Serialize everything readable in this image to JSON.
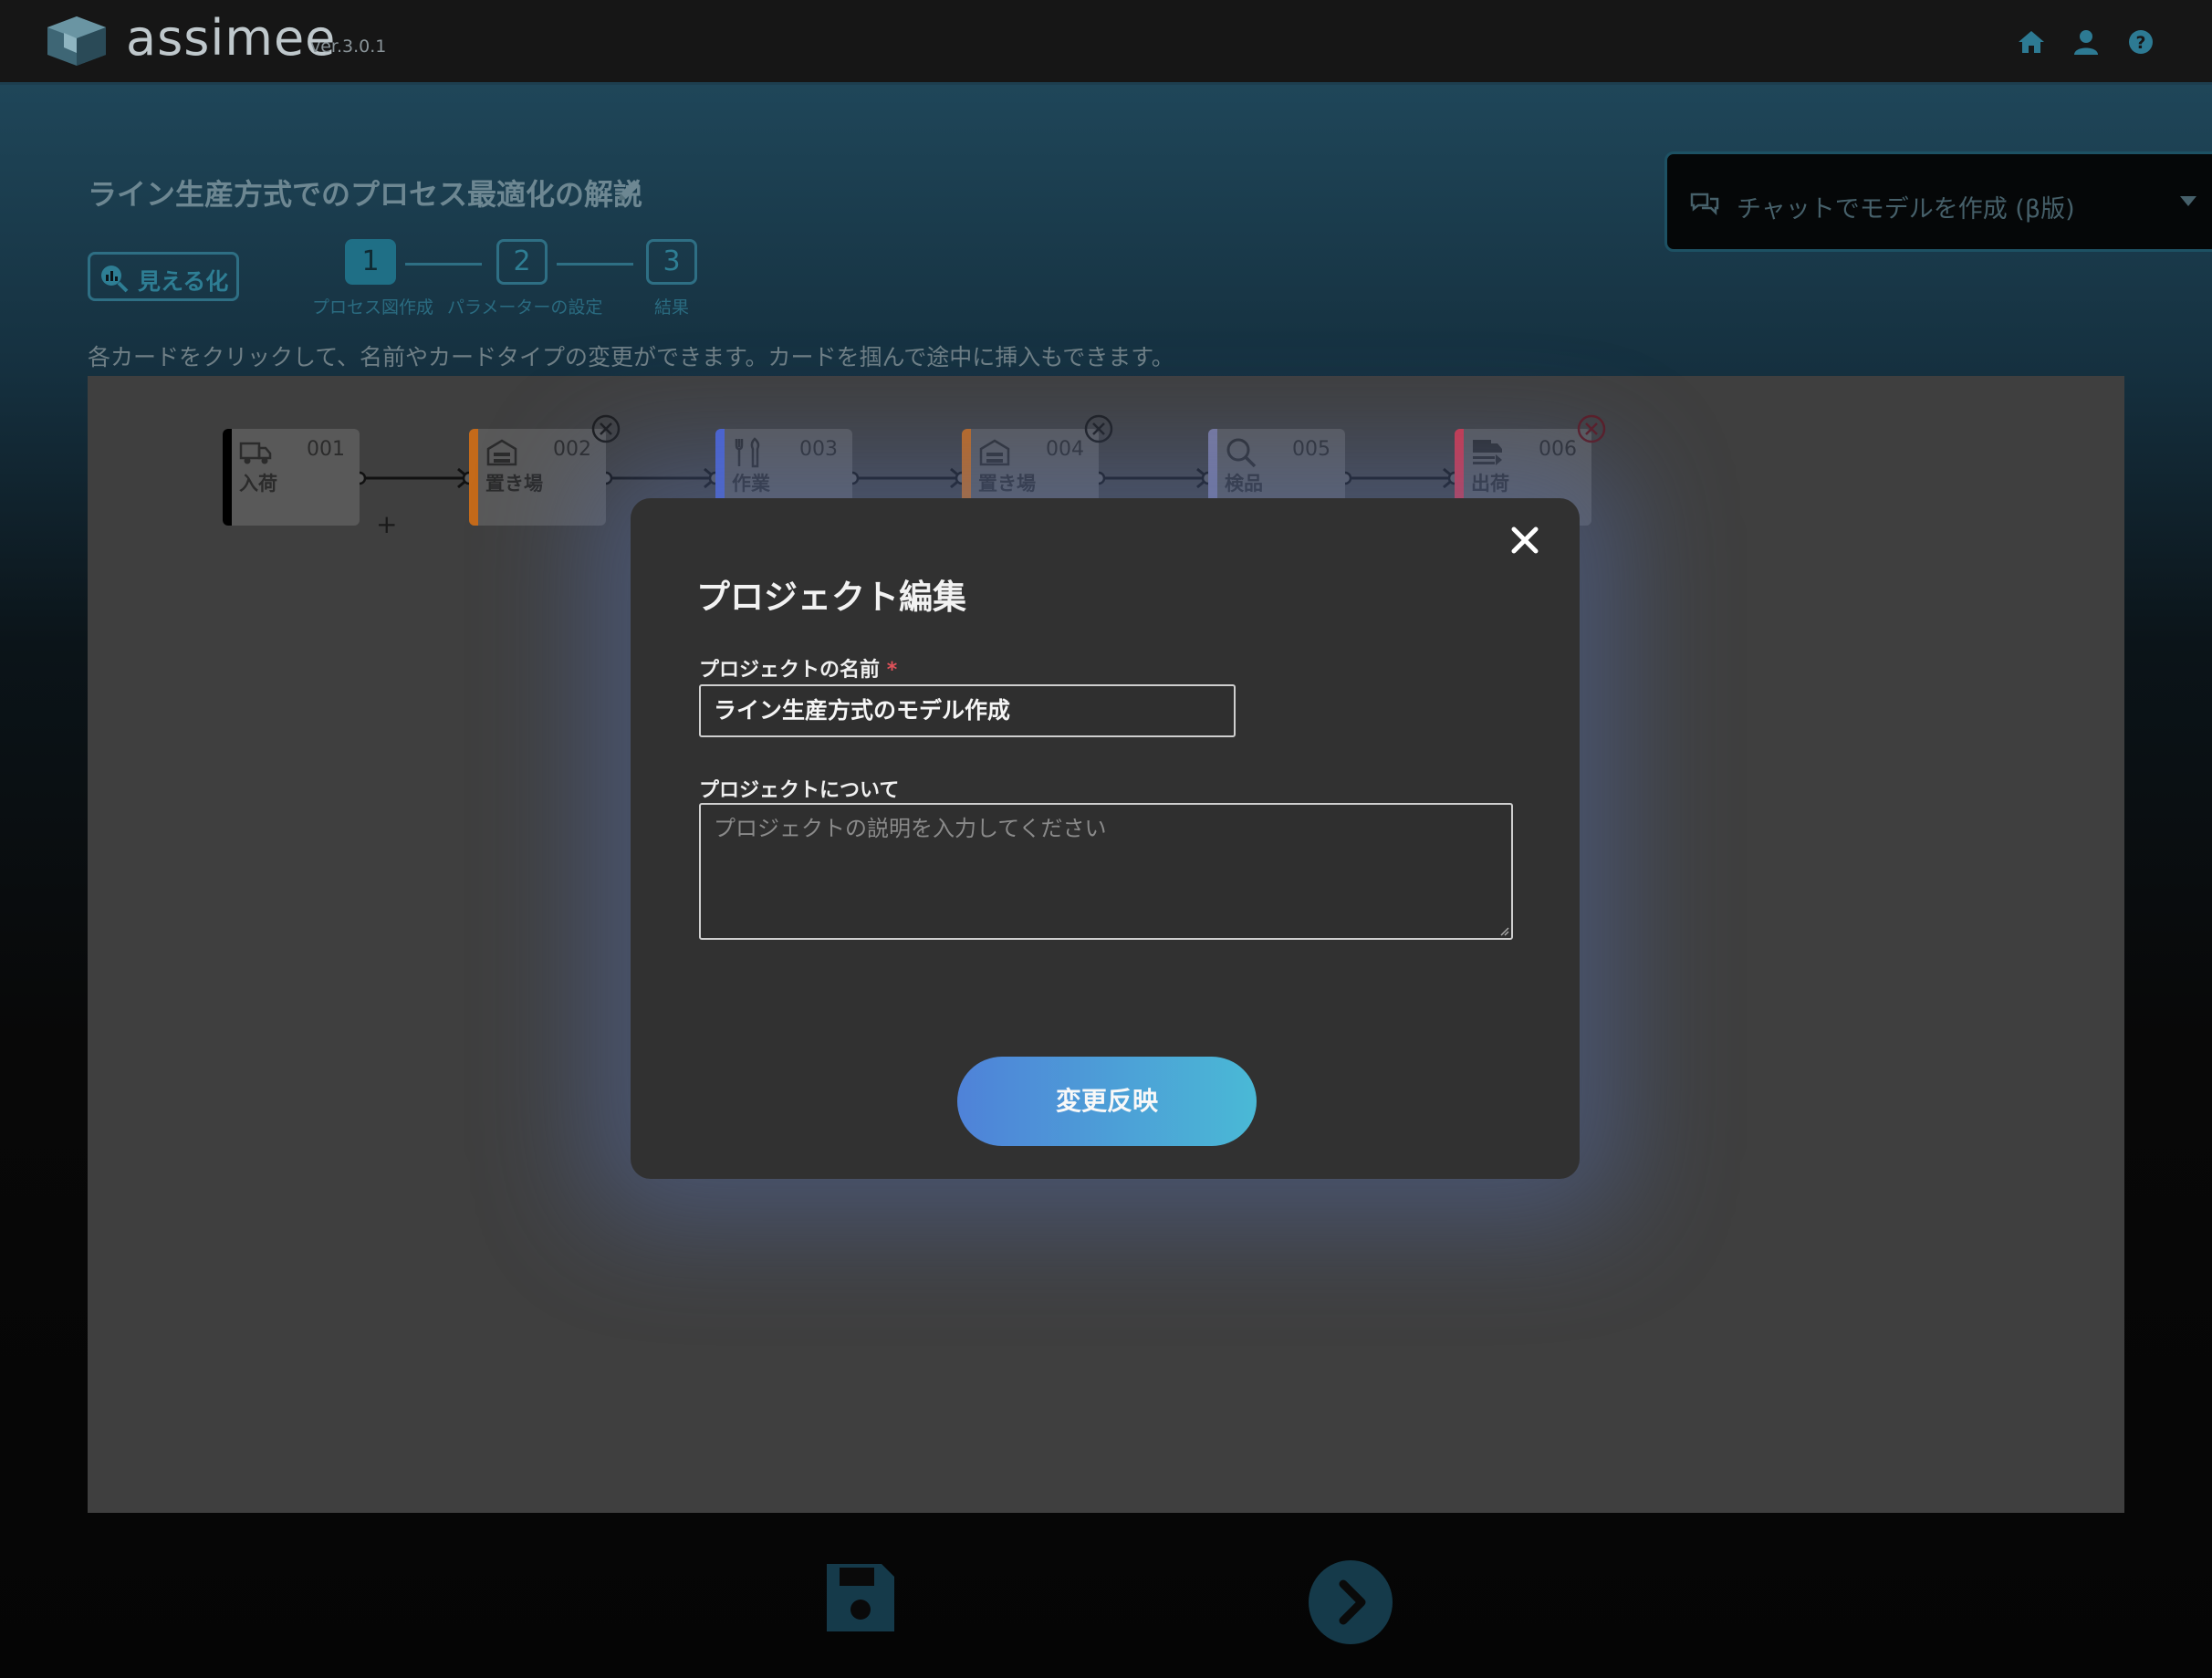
{
  "app": {
    "brand": "assimee",
    "version": "ver.3.0.1"
  },
  "header_icons": [
    "home-icon",
    "user-icon",
    "help-icon"
  ],
  "project_title": "ライン生産方式でのプロセス最適化の解説",
  "visualize_button": "見える化",
  "steps": [
    {
      "number": "1",
      "label": "プロセス図作成",
      "active": true
    },
    {
      "number": "2",
      "label": "パラメーターの設定",
      "active": false
    },
    {
      "number": "3",
      "label": "結果",
      "active": false
    }
  ],
  "instruction": "各カードをクリックして、名前やカードタイプの変更ができます。カードを掴んで途中に挿入もできます。",
  "chat": {
    "label": "チャットでモデルを作成 (β版)"
  },
  "cards": [
    {
      "id": "001",
      "label": "入荷",
      "icon": "truck-icon",
      "color": "#000000"
    },
    {
      "id": "002",
      "label": "置き場",
      "icon": "warehouse-icon",
      "color": "#c46a1a"
    },
    {
      "id": "003",
      "label": "作業",
      "icon": "tools-icon",
      "color": "#4a63d6"
    },
    {
      "id": "004",
      "label": "置き場",
      "icon": "warehouse-icon",
      "color": "#c46a1a"
    },
    {
      "id": "005",
      "label": "検品",
      "icon": "magnifier-icon",
      "color": "#7a7aa0"
    },
    {
      "id": "006",
      "label": "出荷",
      "icon": "shipping-icon",
      "color": "#d2364a"
    }
  ],
  "modal": {
    "title": "プロジェクト編集",
    "name_label": "プロジェクトの名前",
    "required_mark": "*",
    "name_value": "ライン生産方式のモデル作成",
    "about_label": "プロジェクトについて",
    "about_placeholder": "プロジェクトの説明を入力してください",
    "submit_label": "変更反映"
  },
  "colors": {
    "accent": "#2e7e94",
    "button_start": "#4f82d8",
    "button_end": "#4ab9d6"
  }
}
